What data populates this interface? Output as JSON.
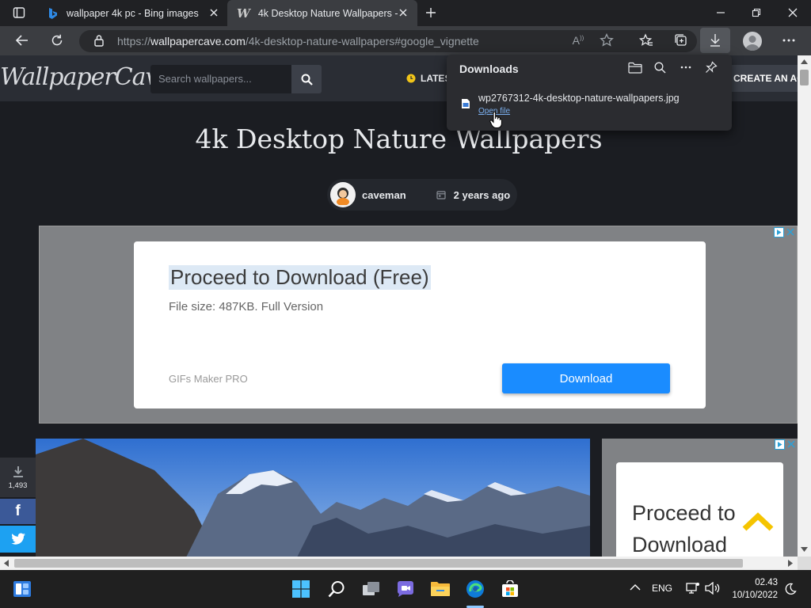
{
  "browser": {
    "tabs": [
      {
        "label": "wallpaper 4k pc - Bing images",
        "active": false
      },
      {
        "label": "4k Desktop Nature Wallpapers -",
        "active": true
      }
    ],
    "url_prefix": "https://",
    "url_domain": "wallpapercave.com",
    "url_path": "/4k-desktop-nature-wallpapers#google_vignette"
  },
  "site": {
    "logo": "WallpaperCave",
    "search_placeholder": "Search wallpapers...",
    "latest_label": "LATES",
    "create_account_label": "CREATE AN AC"
  },
  "article": {
    "title": "4k Desktop Nature Wallpapers",
    "author": "caveman",
    "date": "2 years ago"
  },
  "ad_main": {
    "title": "Proceed to Download (Free)",
    "subtitle": "File size: 487KB. Full Version",
    "brand": "GIFs Maker PRO",
    "button_label": "Download"
  },
  "ad_side": {
    "line1": "Proceed to",
    "line2": "Download"
  },
  "share": {
    "download_count": "1,493"
  },
  "downloads_panel": {
    "title": "Downloads",
    "file_name": "wp2767312-4k-desktop-nature-wallpapers.jpg",
    "open_file_label": "Open file"
  },
  "taskbar": {
    "language": "ENG",
    "time": "02.43",
    "date": "10/10/2022"
  },
  "colors": {
    "accent_blue": "#1a8cff",
    "tab_active": "#3b3d41",
    "chrome_dark": "#202124"
  }
}
